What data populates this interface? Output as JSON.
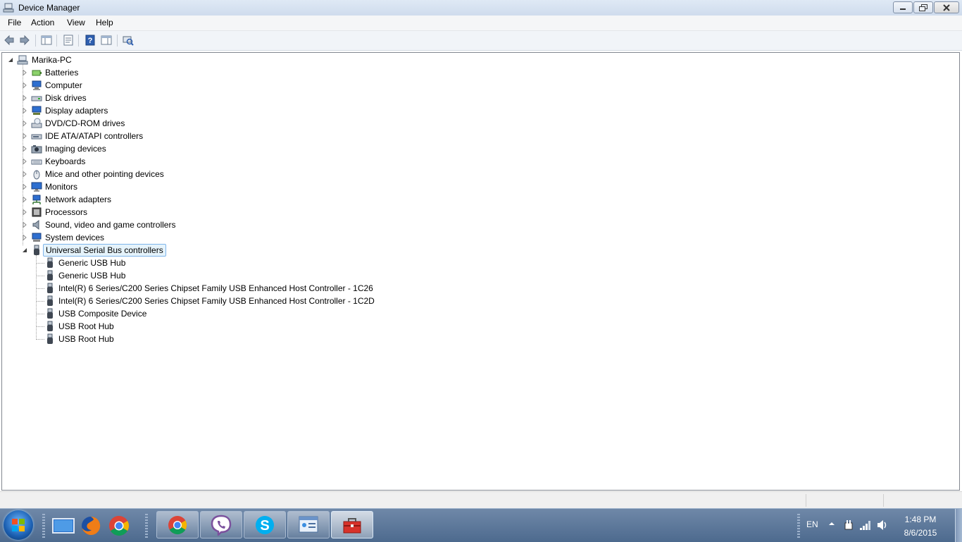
{
  "window": {
    "title": "Device Manager"
  },
  "menu": [
    "File",
    "Action",
    "View",
    "Help"
  ],
  "toolbar": {
    "buttons": [
      {
        "name": "back-arrow-icon"
      },
      {
        "name": "forward-arrow-icon"
      },
      {
        "name": "show-hide-console-tree-icon"
      },
      {
        "name": "properties-icon"
      },
      {
        "name": "help-icon"
      },
      {
        "name": "action-pane-icon"
      },
      {
        "name": "scan-hardware-icon"
      }
    ]
  },
  "tree": {
    "root": "Marika-PC",
    "categories": [
      {
        "label": "Batteries",
        "icon": "battery-icon"
      },
      {
        "label": "Computer",
        "icon": "computer-icon"
      },
      {
        "label": "Disk drives",
        "icon": "disk-drive-icon"
      },
      {
        "label": "Display adapters",
        "icon": "display-adapter-icon"
      },
      {
        "label": "DVD/CD-ROM drives",
        "icon": "dvd-drive-icon"
      },
      {
        "label": "IDE ATA/ATAPI controllers",
        "icon": "ide-controller-icon"
      },
      {
        "label": "Imaging devices",
        "icon": "camera-icon"
      },
      {
        "label": "Keyboards",
        "icon": "keyboard-icon"
      },
      {
        "label": "Mice and other pointing devices",
        "icon": "mouse-icon"
      },
      {
        "label": "Monitors",
        "icon": "monitor-icon"
      },
      {
        "label": "Network adapters",
        "icon": "network-adapter-icon"
      },
      {
        "label": "Processors",
        "icon": "processor-icon"
      },
      {
        "label": "Sound, video and game controllers",
        "icon": "speaker-icon"
      },
      {
        "label": "System devices",
        "icon": "system-devices-icon"
      },
      {
        "label": "Universal Serial Bus controllers",
        "icon": "usb-icon",
        "expanded": true,
        "selected": true
      }
    ],
    "usb_children": [
      "Generic USB Hub",
      "Generic USB Hub",
      "Intel(R) 6 Series/C200 Series Chipset Family USB Enhanced Host Controller - 1C26",
      "Intel(R) 6 Series/C200 Series Chipset Family USB Enhanced Host Controller - 1C2D",
      "USB Composite Device",
      "USB Root Hub",
      "USB Root Hub"
    ]
  },
  "taskbar": {
    "quick_launch": [
      "show-desktop-icon",
      "firefox-icon",
      "chrome-icon"
    ],
    "tasks": [
      "chrome-icon",
      "viber-icon",
      "skype-icon",
      "control-panel-icon",
      "toolbox-icon"
    ],
    "tray": {
      "language": "EN",
      "time": "1:48 PM",
      "date": "8/6/2015"
    }
  },
  "colors": {
    "selection_bg": "#e5f3fb",
    "selection_border": "#7eb4ea",
    "taskbar": "#5b779b"
  }
}
